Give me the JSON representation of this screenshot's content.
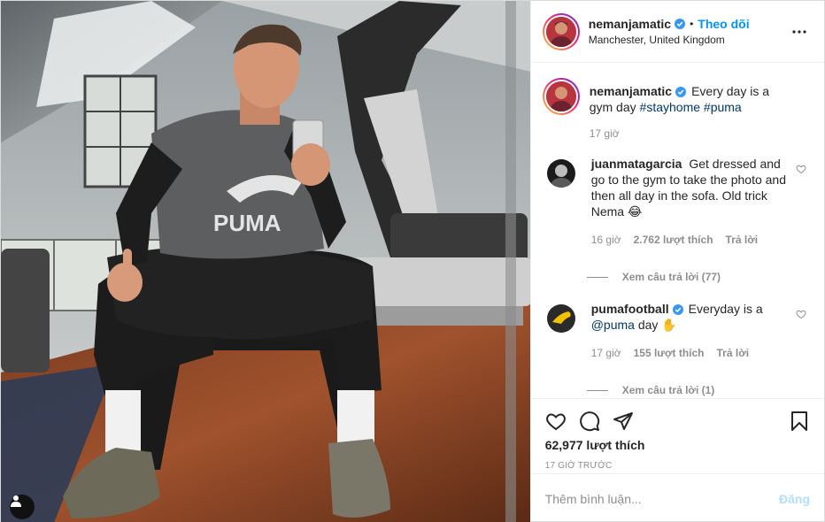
{
  "post": {
    "author": {
      "username": "nemanjamatic",
      "verified": true,
      "follow_label": "Theo dõi",
      "location": "Manchester, United Kingdom",
      "avatar_icon": "profile-avatar"
    },
    "caption": {
      "username": "nemanjamatic",
      "text": "Every day is a gym day",
      "hashtags": [
        "#stayhome",
        "#puma"
      ],
      "time": "17 giờ"
    },
    "comments": [
      {
        "username": "juanmatagarcia",
        "verified": true,
        "text": "Get dressed and go to the gym to take the photo and then all day in the sofa. Old trick Nema 😂",
        "time": "16 giờ",
        "likes": "2.762 lượt thích",
        "reply_label": "Trả lời",
        "view_replies": "Xem câu trả lời (77)"
      },
      {
        "username": "pumafootball",
        "verified": true,
        "text_before": "Everyday is a",
        "mention": "@puma",
        "text_after": "day ✋",
        "time": "17 giờ",
        "likes": "155 lượt thích",
        "reply_label": "Trả lời",
        "view_replies": "Xem câu trả lời (1)"
      }
    ],
    "likes_count": "62,977 lượt thích",
    "posted_ago": "17 GIỜ TRƯỚC",
    "comment_placeholder": "Thêm bình luận...",
    "post_button": "Đăng",
    "colors": {
      "link": "#0095f6",
      "hashtag": "#00376b",
      "muted": "#8e8e8e",
      "post_disabled": "#b2dffc"
    }
  }
}
